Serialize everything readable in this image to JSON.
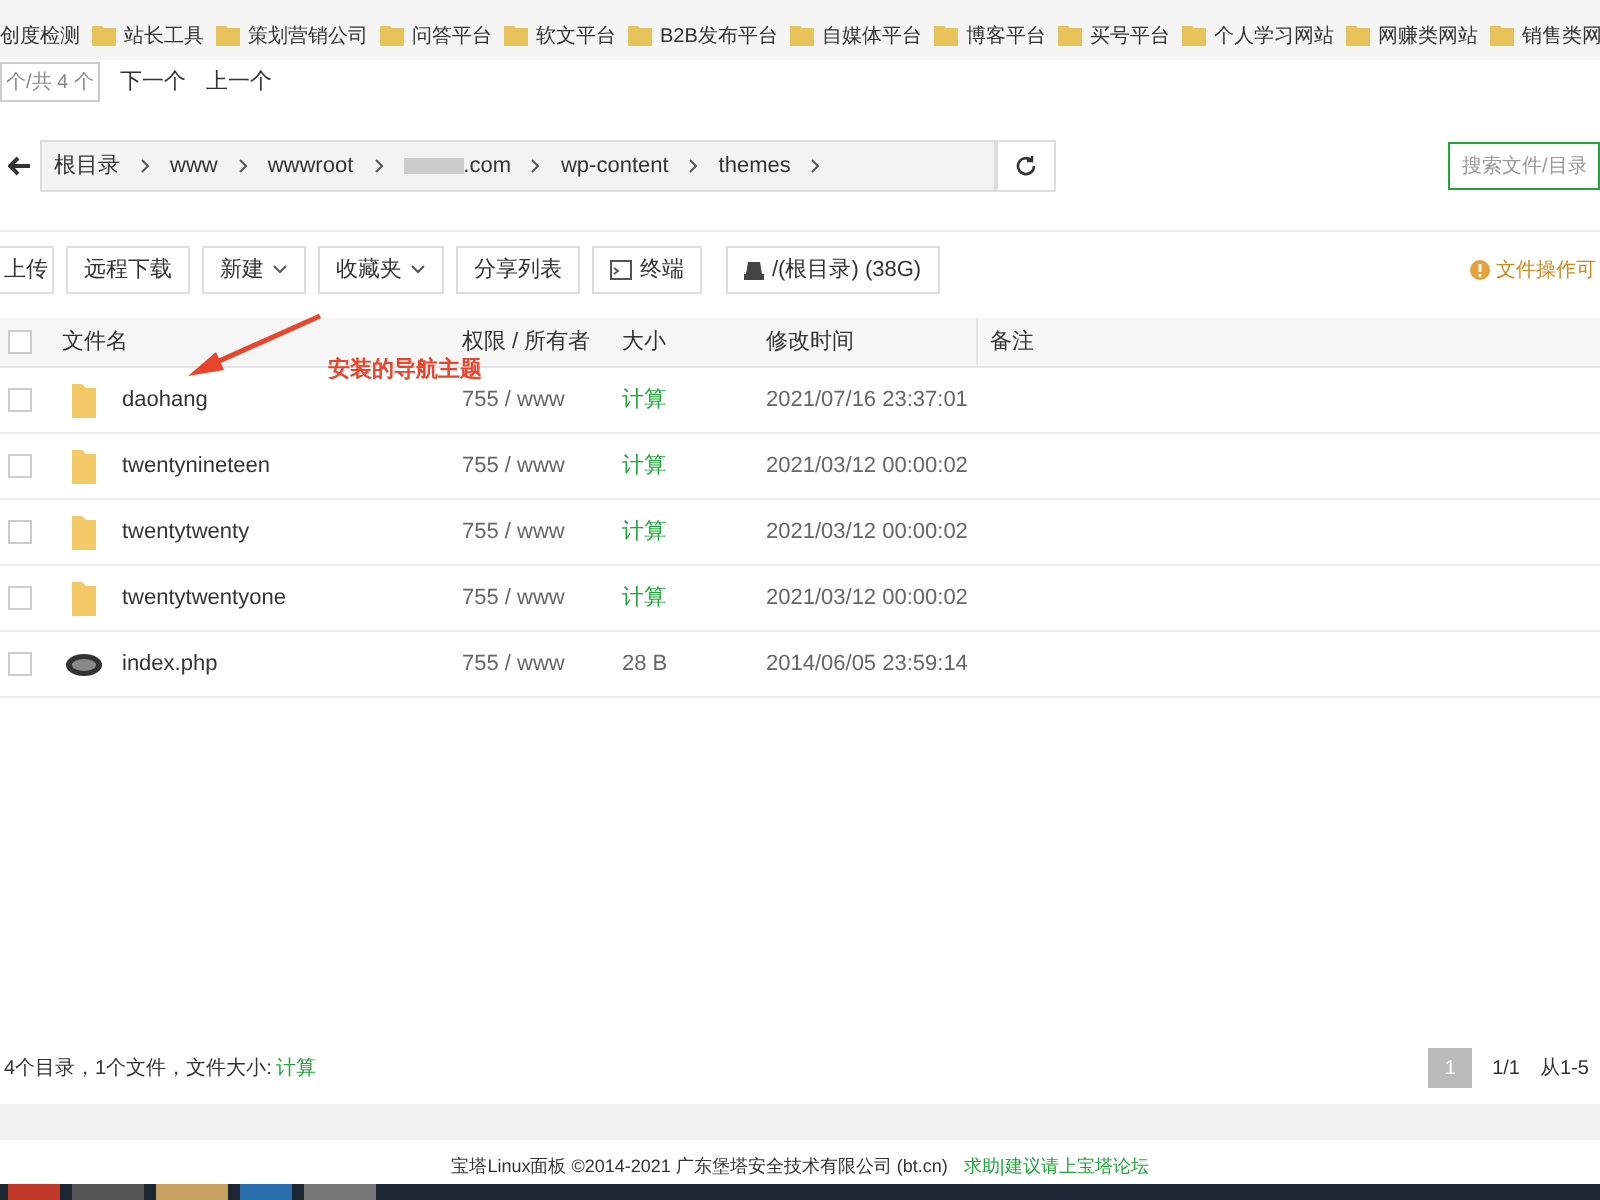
{
  "bookmarks": [
    "创度检测",
    "站长工具",
    "策划营销公司",
    "问答平台",
    "软文平台",
    "B2B发布平台",
    "自媒体平台",
    "博客平台",
    "买号平台",
    "个人学习网站",
    "网赚类网站",
    "销售类网"
  ],
  "find_bar": {
    "value": "个/共 4 个",
    "buttons": [
      "下一个",
      "上一个"
    ]
  },
  "breadcrumb": [
    "根目录",
    "www",
    "wwwroot",
    ".com",
    "wp-content",
    "themes"
  ],
  "search": {
    "placeholder": "搜索文件/目录"
  },
  "toolbar": [
    {
      "label": "上传",
      "kind": "plain"
    },
    {
      "label": "远程下载",
      "kind": "plain"
    },
    {
      "label": "新建",
      "kind": "dropdown"
    },
    {
      "label": "收藏夹",
      "kind": "dropdown"
    },
    {
      "label": "分享列表",
      "kind": "plain"
    },
    {
      "label": "终端",
      "kind": "terminal"
    },
    {
      "label": "/(根目录) (38G)",
      "kind": "disk"
    }
  ],
  "notice": "文件操作可",
  "table": {
    "all_checked": false,
    "columns": [
      "文件名",
      "权限 / 所有者",
      "大小",
      "修改时间",
      "备注"
    ],
    "rows": [
      {
        "kind": "folder",
        "name": "daohang",
        "perm": "755 / www",
        "size": "计算",
        "mtime": "2021/07/16 23:37:01",
        "checked": false
      },
      {
        "kind": "folder",
        "name": "twentynineteen",
        "perm": "755 / www",
        "size": "计算",
        "mtime": "2021/03/12 00:00:02",
        "checked": false
      },
      {
        "kind": "folder",
        "name": "twentytwenty",
        "perm": "755 / www",
        "size": "计算",
        "mtime": "2021/03/12 00:00:02",
        "checked": false
      },
      {
        "kind": "folder",
        "name": "twentytwentyone",
        "perm": "755 / www",
        "size": "计算",
        "mtime": "2021/03/12 00:00:02",
        "checked": false
      },
      {
        "kind": "php",
        "name": "index.php",
        "perm": "755 / www",
        "size": "28 B",
        "mtime": "2014/06/05 23:59:14",
        "checked": false
      }
    ]
  },
  "annotation": "安装的导航主题",
  "summary": {
    "text": "4个目录，1个文件，文件大小:",
    "link": "计算"
  },
  "pagination": {
    "pages": [
      {
        "label": "1",
        "selected": true
      }
    ],
    "total": "1/1",
    "range": "从1-5"
  },
  "footer": {
    "text": "宝塔Linux面板 ©2014-2021 广东堡塔安全技术有限公司 (bt.cn)",
    "link": "求助|建议请上宝塔论坛"
  }
}
